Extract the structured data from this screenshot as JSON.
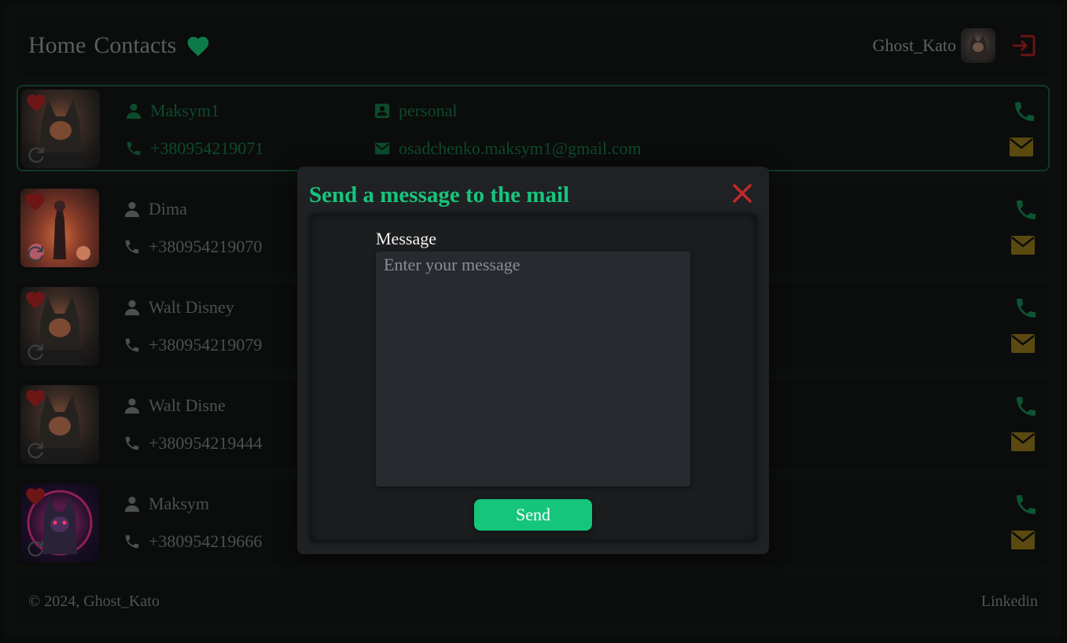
{
  "header": {
    "nav": [
      "Home",
      "Contacts"
    ],
    "username": "Ghost_Kato"
  },
  "contacts": [
    {
      "name": "Maksym1",
      "phone": "+380954219071",
      "group": "personal",
      "email": "osadchenko.maksym1@gmail.com"
    },
    {
      "name": "Dima",
      "phone": "+380954219070"
    },
    {
      "name": "Walt Disney",
      "phone": "+380954219079"
    },
    {
      "name": "Walt Disne",
      "phone": "+380954219444"
    },
    {
      "name": "Maksym",
      "phone": "+380954219666"
    }
  ],
  "footer": {
    "copyright": "© 2024, Ghost_Kato",
    "link": "Linkedin"
  },
  "modal": {
    "title": "Send a message to the mail",
    "label": "Message",
    "placeholder": "Enter your message",
    "send": "Send"
  },
  "colors": {
    "accent": "#16c57c",
    "close": "#c22a2a",
    "mail": "#5a4a10",
    "phone": "#0d4a2b"
  }
}
